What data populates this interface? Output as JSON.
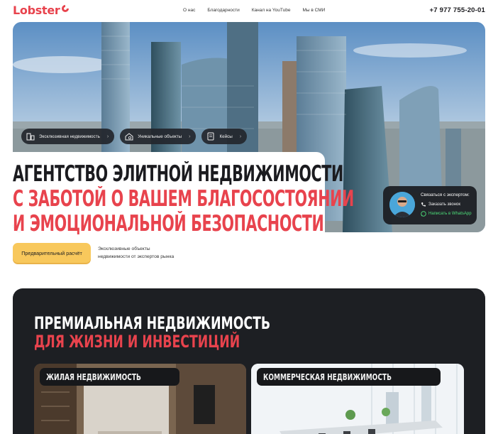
{
  "header": {
    "logo": "Lobster",
    "nav": [
      "О нас",
      "Благодарности",
      "Канал на YouTube",
      "Мы в СМИ"
    ],
    "phone": "+7 977 755-20-01"
  },
  "hero": {
    "pills": [
      {
        "label": "Эксклюзивная недвижимость",
        "icon": "building-icon"
      },
      {
        "label": "Уникальные объекты",
        "icon": "house-search-icon"
      },
      {
        "label": "Кейсы",
        "icon": "briefcase-icon"
      }
    ],
    "headline": {
      "line1": "АГЕНТСТВО ЭЛИТНОЙ НЕДВИЖИМОСТИ",
      "line2": "С ЗАБОТОЙ О ВАШЕМ БЛАГОСОСТОЯНИИ",
      "line3": "И ЭМОЦИОНАЛЬНОЙ БЕЗОПАСНОСТИ"
    },
    "contact": {
      "title": "Связаться с экспертом:",
      "call": "Заказать звонок",
      "whatsapp": "Написать в WhatsApp"
    },
    "cta": "Предварительный расчёт",
    "subtext_line1": "Эксклюзивные объекты",
    "subtext_line2": "недвижимости от экспертов рынка"
  },
  "section": {
    "title1": "ПРЕМИАЛЬНАЯ НЕДВИЖИМОСТЬ",
    "title2": "ДЛЯ ЖИЗНИ И ИНВЕСТИЦИЙ",
    "cards": [
      {
        "label": "ЖИЛАЯ НЕДВИЖИМОСТЬ"
      },
      {
        "label": "КОММЕРЧЕСКАЯ НЕДВИЖИМОСТЬ"
      }
    ]
  },
  "colors": {
    "accent_red": "#e8434d",
    "cta_yellow": "#f8c85c",
    "dark_bg": "#1d1f23",
    "whatsapp_green": "#4ddf7a"
  }
}
